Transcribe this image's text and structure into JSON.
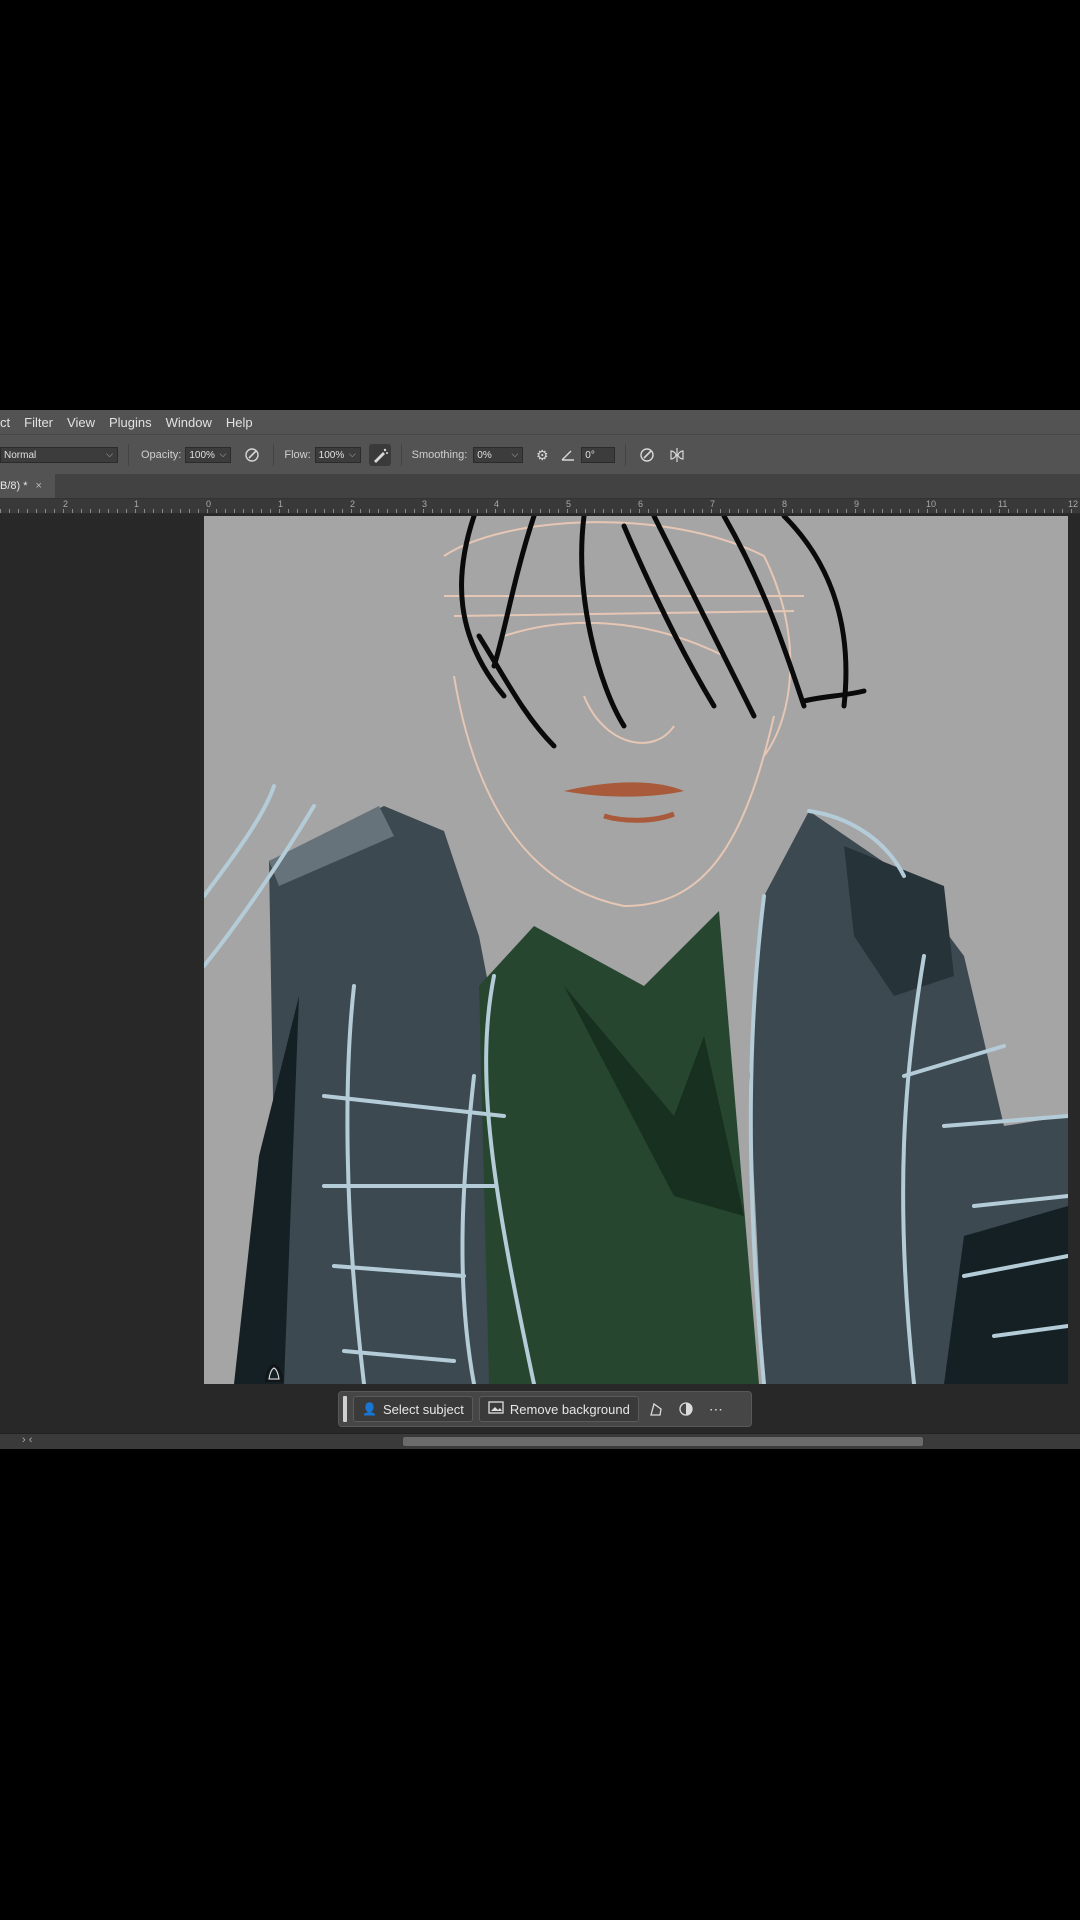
{
  "menu": [
    "ct",
    "Filter",
    "View",
    "Plugins",
    "Window",
    "Help"
  ],
  "options": {
    "mode": "Normal",
    "opacity_label": "Opacity:",
    "opacity_value": "100%",
    "flow_label": "Flow:",
    "flow_value": "100%",
    "smoothing_label": "Smoothing:",
    "smoothing_value": "0%",
    "angle_value": "0°"
  },
  "tab": {
    "title": "B/8) *",
    "close": "×"
  },
  "ruler": {
    "labels": [
      "2",
      "1",
      "0",
      "1",
      "2",
      "3",
      "4",
      "5",
      "6",
      "7",
      "8",
      "9",
      "10",
      "11",
      "12"
    ]
  },
  "contextual_taskbar": {
    "select_subject": "Select subject",
    "remove_background": "Remove background"
  },
  "scrollbar": {
    "arrows": "› ‹"
  },
  "colors": {
    "canvas_bg": "#a5a5a5",
    "jacket": "#3d4950",
    "shirt": "#264630",
    "hair": "#0a0a0a",
    "skin_sketch": "#e6c6b4",
    "lips": "#a85a3a",
    "highlight": "#b4ccd8"
  }
}
